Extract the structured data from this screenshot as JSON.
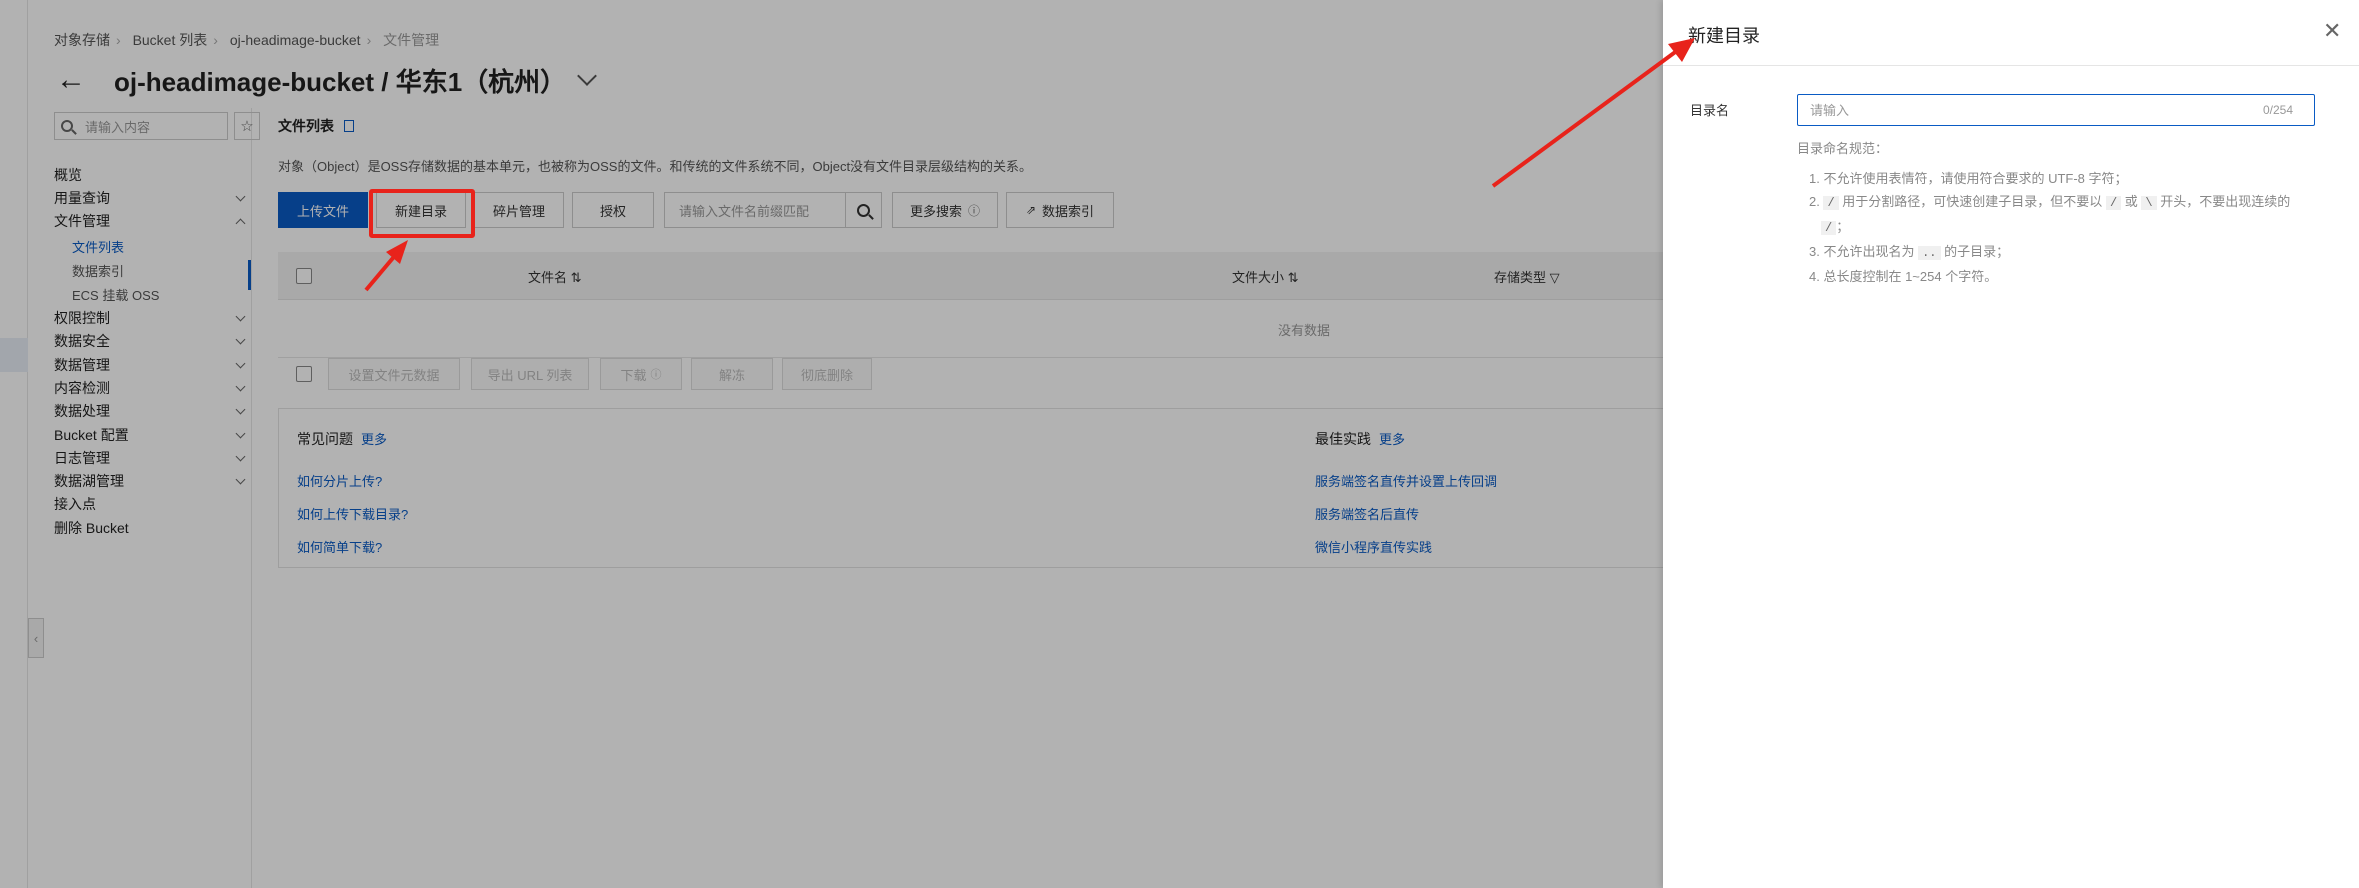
{
  "breadcrumb": {
    "root": "对象存储",
    "list": "Bucket 列表",
    "bucket": "oj-headimage-bucket",
    "current": "文件管理"
  },
  "header": {
    "title": "oj-headimage-bucket / 华东1（杭州）"
  },
  "sidebar": {
    "search_placeholder": "请输入内容",
    "items": [
      "概览",
      "用量查询",
      "文件管理",
      "文件列表",
      "数据索引",
      "ECS 挂载 OSS",
      "权限控制",
      "数据安全",
      "数据管理",
      "内容检测",
      "数据处理",
      "Bucket 配置",
      "日志管理",
      "数据湖管理",
      "接入点",
      "删除 Bucket"
    ]
  },
  "main": {
    "title": "文件列表",
    "description": "对象（Object）是OSS存储数据的基本单元，也被称为OSS的文件。和传统的文件系统不同，Object没有文件目录层级结构的关系。",
    "toolbar": {
      "upload": "上传文件",
      "new_dir": "新建目录",
      "fragments": "碎片管理",
      "authorize": "授权",
      "search_placeholder": "请输入文件名前缀匹配",
      "more_search": "更多搜索",
      "data_index": "数据索引"
    },
    "table": {
      "col_name": "文件名",
      "col_size": "文件大小",
      "col_storage": "存储类型",
      "empty": "没有数据"
    },
    "bulk": {
      "set_meta": "设置文件元数据",
      "export_url": "导出 URL 列表",
      "download": "下载",
      "unfreeze": "解冻",
      "delete": "彻底删除"
    },
    "faq": {
      "title": "常见问题",
      "more": "更多",
      "links": [
        "如何分片上传?",
        "如何上传下载目录?",
        "如何简单下载?"
      ]
    },
    "best": {
      "title": "最佳实践",
      "more": "更多",
      "links": [
        "服务端签名直传并设置上传回调",
        "服务端签名后直传",
        "微信小程序直传实践"
      ]
    }
  },
  "drawer": {
    "title": "新建目录",
    "field_label": "目录名",
    "input_value": "",
    "input_placeholder": "请输入",
    "counter": "0/254",
    "rules_title": "目录命名规范：",
    "rule1": "1. 不允许使用表情符，请使用符合要求的 UTF-8 字符；",
    "rule2a": "2.",
    "rule2_slash": "/",
    "rule2b": "用于分割路径，可快速创建子目录，但不要以",
    "rule2c": "或",
    "rule2_backslash": "\\",
    "rule2d": "开头，不要出现连续的",
    "rule2e": "；",
    "rule3a": "3. 不允许出现名为",
    "rule3_dots": "..",
    "rule3b": "的子目录；",
    "rule4": "4. 总长度控制在 1~254 个字符。"
  },
  "colors": {
    "accent": "#0a5bc4",
    "annotation": "#e8231b"
  }
}
